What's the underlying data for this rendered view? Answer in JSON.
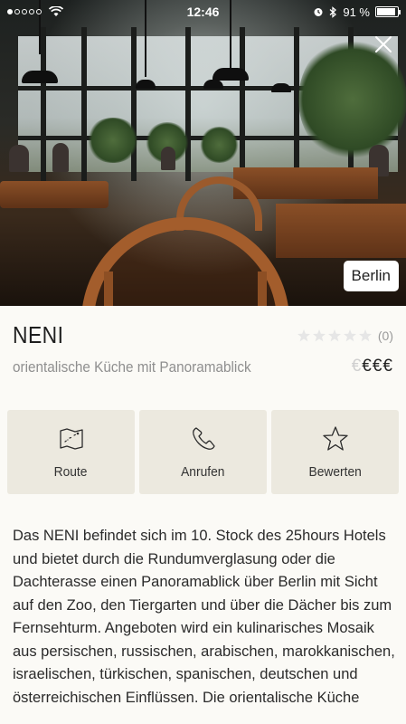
{
  "status_bar": {
    "carrier_dots": 5,
    "signal_strength": 1,
    "time": "12:46",
    "battery_text": "91 %",
    "battery_level": 0.91
  },
  "hero": {
    "city_badge": "Berlin"
  },
  "restaurant": {
    "name": "NENI",
    "subtitle": "orientalische Küche mit Panoramablick",
    "rating_count": "(0)",
    "rating_value": 0,
    "rating_max": 5,
    "price_symbol": "€",
    "price_level": 3,
    "price_max": 4
  },
  "actions": [
    {
      "label": "Route",
      "icon": "map-icon"
    },
    {
      "label": "Anrufen",
      "icon": "phone-icon"
    },
    {
      "label": "Bewerten",
      "icon": "star-icon"
    }
  ],
  "description": "Das NENI befindet sich im 10. Stock des 25hours Hotels und bietet durch die Rundumverglasung oder die Dachterasse einen Panoramablick über Berlin mit Sicht auf den Zoo, den Tiergarten und über die Dächer bis zum Fernsehturm. Angeboten wird ein kulinarisches Mosaik aus persischen, russischen, arabischen, marokkanischen, israelischen, türkischen, spanischen, deutschen und österreichischen Einflüssen. Die orientalische Küche",
  "colors": {
    "background": "#fbfaf6",
    "button_bg": "#ece9df",
    "muted_text": "#8f8f8f"
  }
}
